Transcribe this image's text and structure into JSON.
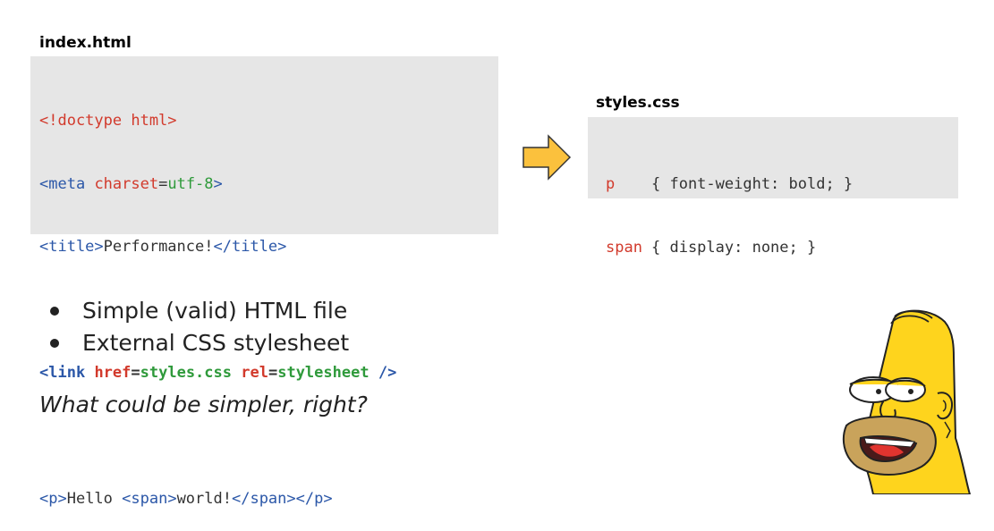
{
  "html_file": {
    "title": "index.html",
    "lines": {
      "l1": "<!doctype html>",
      "l2_tag_open": "<meta",
      "l2_attr": "charset",
      "l2_eq": "=",
      "l2_val": "utf-8",
      "l2_close": ">",
      "l3_open": "<title>",
      "l3_text": "Performance!",
      "l3_close": "</title>",
      "l4_open": "<link",
      "l4_attr1": "href",
      "l4_eq1": "=",
      "l4_val1": "styles.css",
      "l4_attr2": "rel",
      "l4_eq2": "=",
      "l4_val2": "stylesheet",
      "l4_close": "/>",
      "l5_p_open": "<p>",
      "l5_text1": "Hello ",
      "l5_span_open": "<span>",
      "l5_text2": "world!",
      "l5_span_close": "</span>",
      "l5_p_close": "</p>"
    }
  },
  "css_file": {
    "title": "styles.css",
    "rule1_selector": "p",
    "rule1_body": "{ font-weight: bold; }",
    "rule2_selector": "span",
    "rule2_body": "{ display: none; }"
  },
  "bullets": [
    "Simple (valid) HTML file",
    "External CSS stylesheet"
  ],
  "tagline": "What could be simpler, right?",
  "colors": {
    "tag": "#2b57a8",
    "attr": "#d23a2c",
    "value": "#2f9a3b",
    "arrow_fill": "#fbc13d",
    "homer_skin": "#fed41d",
    "stubble": "#c9a35b"
  },
  "icons": {
    "arrow": "right-arrow-icon",
    "character": "homer-simpson-illustration"
  }
}
